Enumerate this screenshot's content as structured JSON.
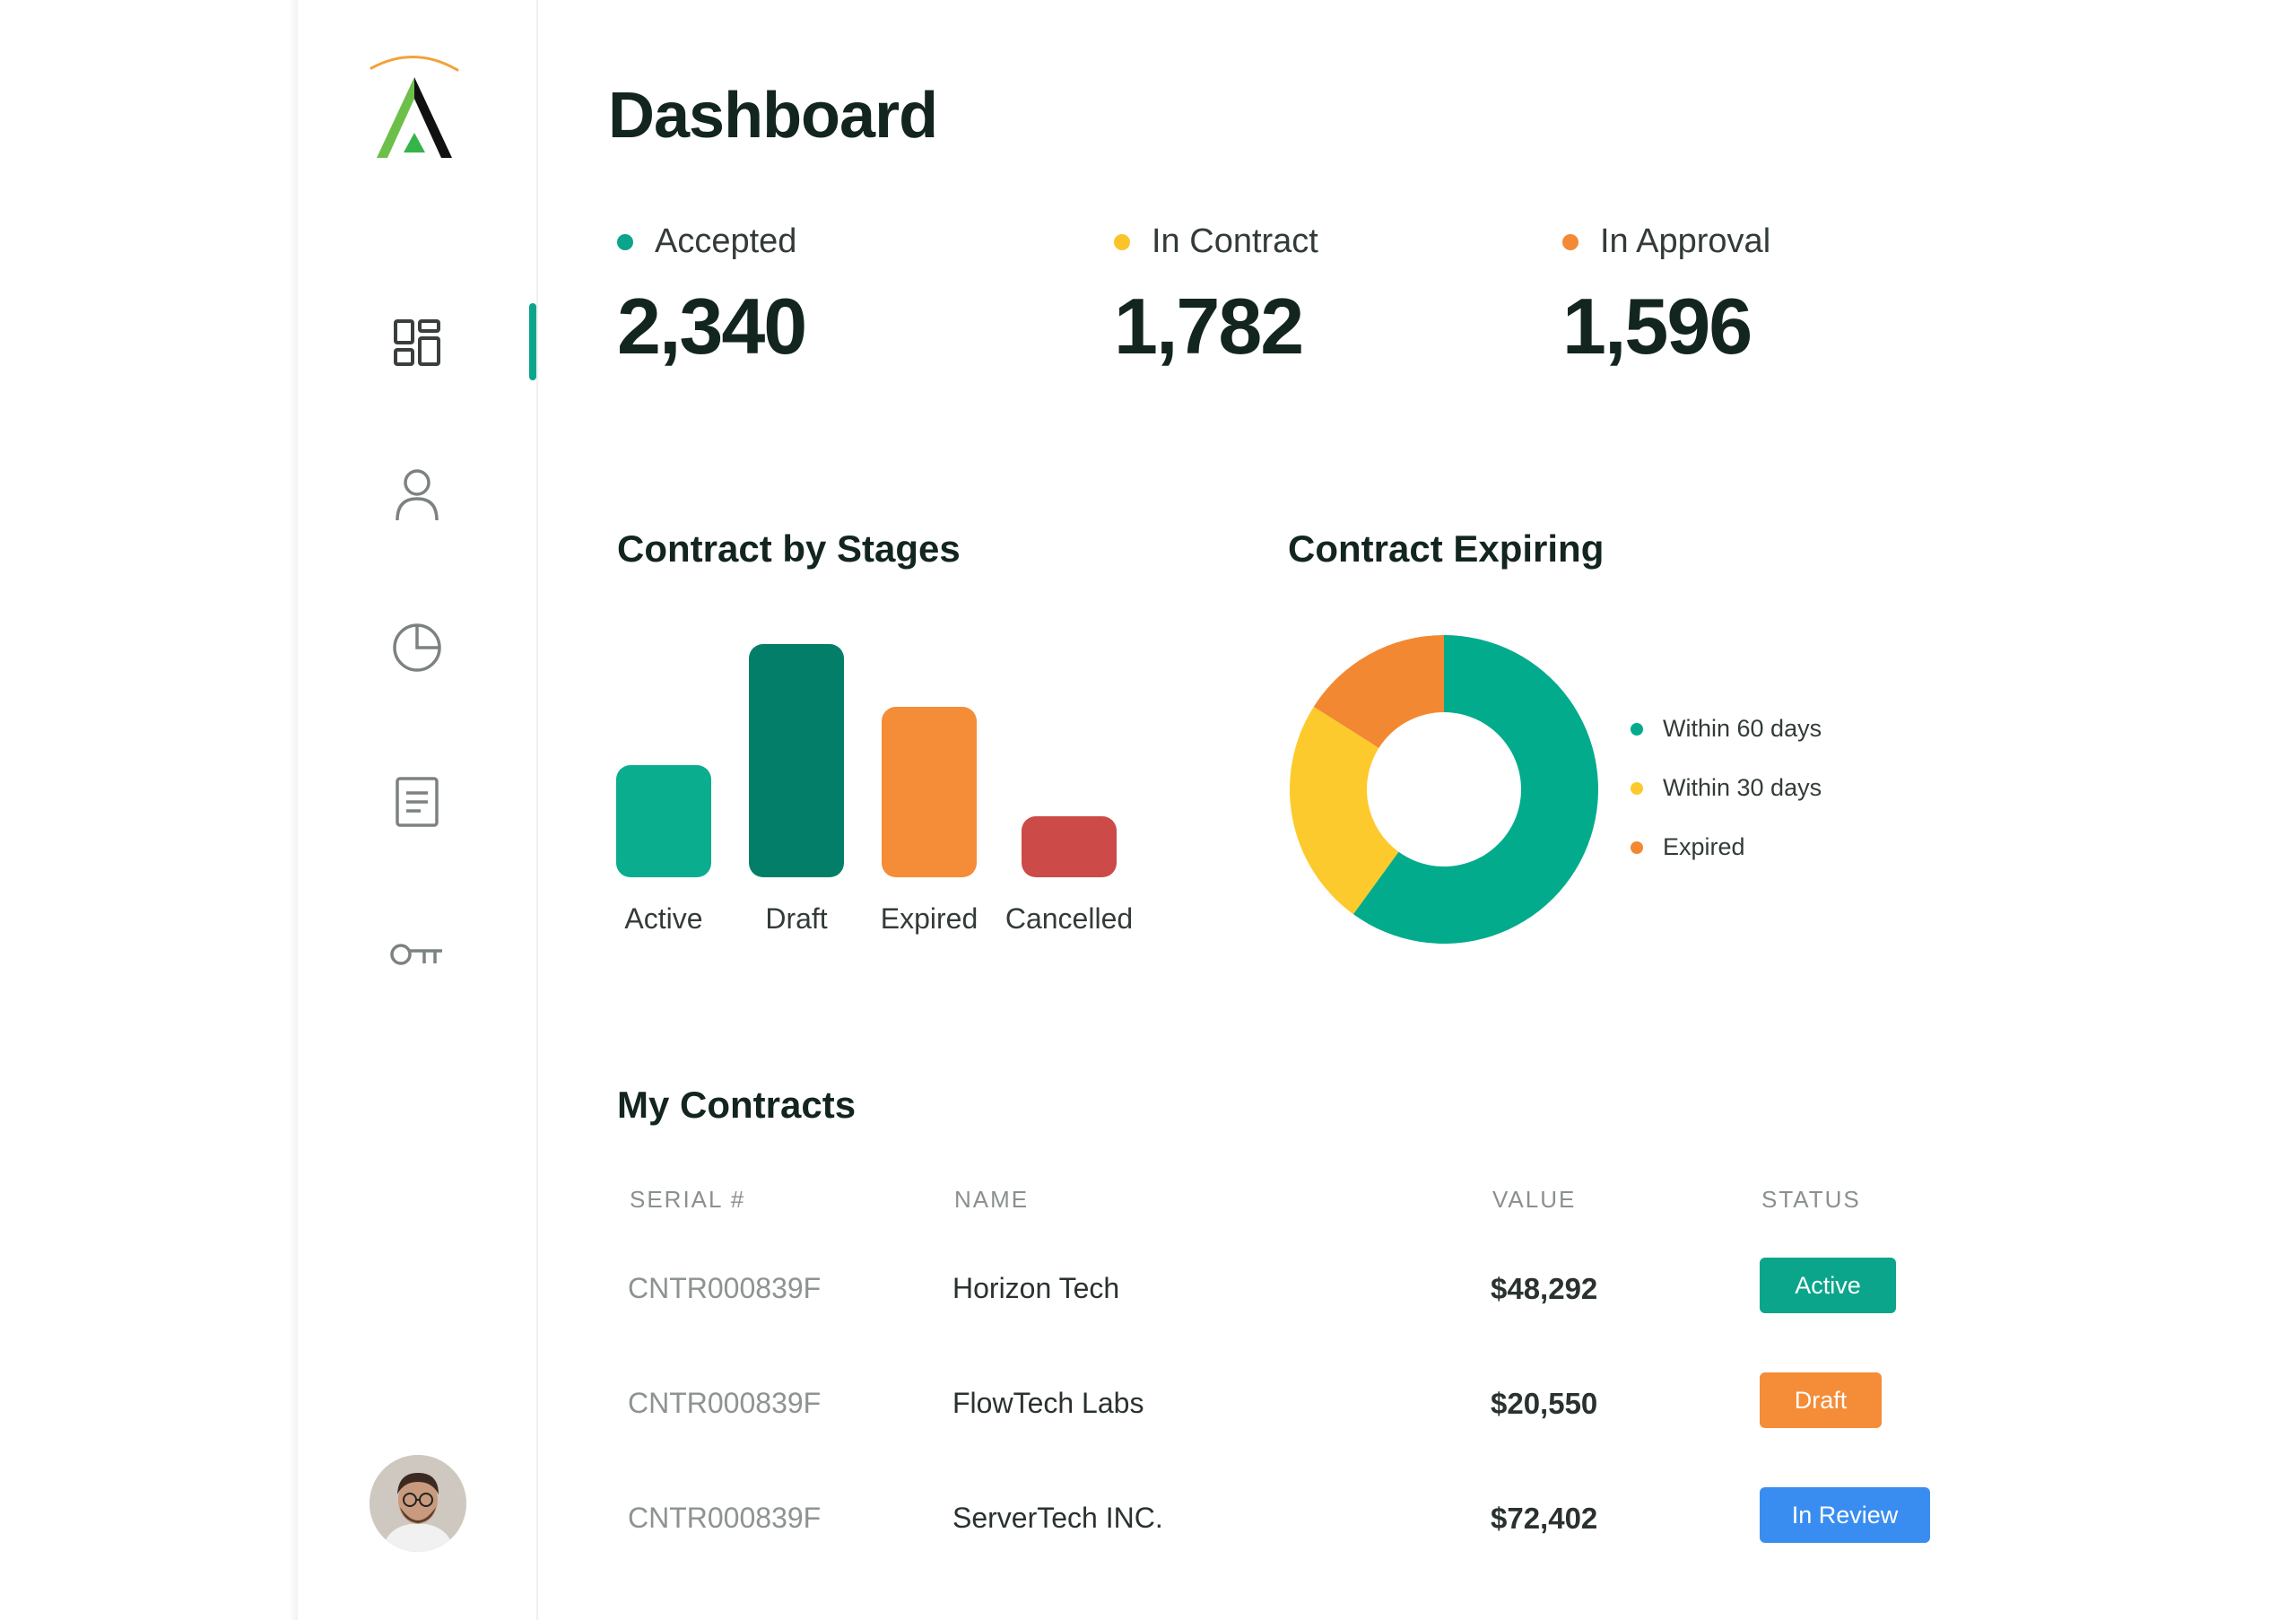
{
  "page": {
    "title": "Dashboard"
  },
  "sidebar": {
    "logo": "app-logo",
    "items": [
      {
        "name": "dashboard",
        "icon": "grid-icon",
        "active": true
      },
      {
        "name": "users",
        "icon": "user-icon",
        "active": false
      },
      {
        "name": "reports",
        "icon": "pie-chart-icon",
        "active": false
      },
      {
        "name": "documents",
        "icon": "document-icon",
        "active": false
      },
      {
        "name": "keys",
        "icon": "key-icon",
        "active": false
      }
    ],
    "avatar": "user-avatar"
  },
  "stats": [
    {
      "label": "Accepted",
      "value": "2,340",
      "color": "#0aa58a"
    },
    {
      "label": "In Contract",
      "value": "1,782",
      "color": "#fbc52a"
    },
    {
      "label": "In Approval",
      "value": "1,596",
      "color": "#f28a36"
    }
  ],
  "contract_by_stages": {
    "title": "Contract by Stages"
  },
  "contract_expiring": {
    "title": "Contract Expiring",
    "legend": [
      {
        "label": "Within 60 days",
        "color": "#02ab8c"
      },
      {
        "label": "Within 30 days",
        "color": "#fdca2d"
      },
      {
        "label": "Expired",
        "color": "#f38832"
      }
    ]
  },
  "chart_data": [
    {
      "type": "bar",
      "title": "Contract by Stages",
      "categories": [
        "Active",
        "Draft",
        "Expired",
        "Cancelled"
      ],
      "values": [
        48,
        100,
        73,
        26
      ],
      "colors": [
        "#0aad8e",
        "#037f69",
        "#f58c37",
        "#cc4a47"
      ],
      "xlabel": "",
      "ylabel": "",
      "ylim": [
        0,
        100
      ],
      "grid": false
    },
    {
      "type": "pie",
      "title": "Contract Expiring",
      "labels": [
        "Within 60 days",
        "Within 30 days",
        "Expired"
      ],
      "values": [
        60,
        24,
        16
      ],
      "colors": [
        "#02ab8c",
        "#fdca2d",
        "#f38832"
      ],
      "legend": "right"
    }
  ],
  "my_contracts": {
    "title": "My Contracts",
    "columns": [
      "SERIAL #",
      "NAME",
      "VALUE",
      "STATUS"
    ],
    "rows": [
      {
        "serial": "CNTR000839F",
        "name": "Horizon Tech",
        "value": "$48,292",
        "status": "Active",
        "status_color": "#0aa58a"
      },
      {
        "serial": "CNTR000839F",
        "name": "FlowTech Labs",
        "value": "$20,550",
        "status": "Draft",
        "status_color": "#f58c37"
      },
      {
        "serial": "CNTR000839F",
        "name": "ServerTech INC.",
        "value": "$72,402",
        "status": "In Review",
        "status_color": "#3a8df0"
      }
    ]
  }
}
